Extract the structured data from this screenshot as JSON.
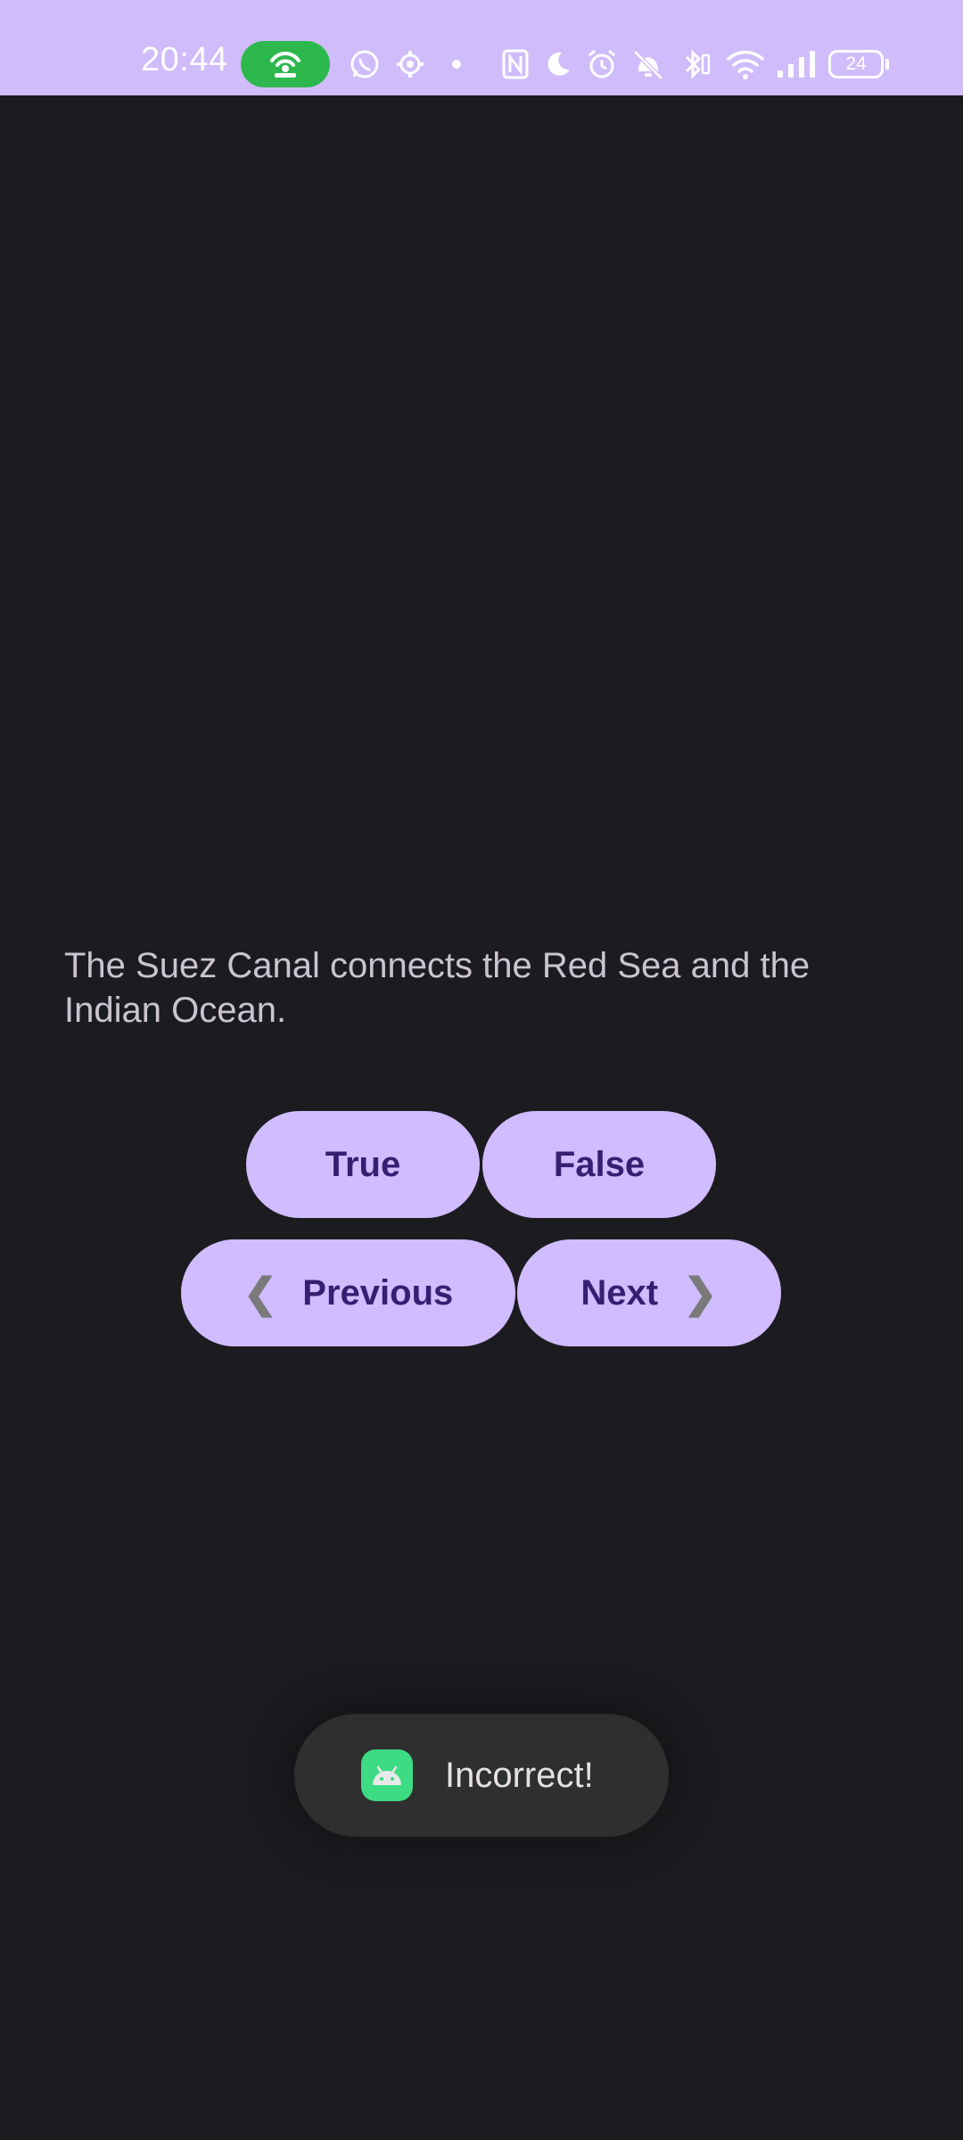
{
  "status_bar": {
    "time": "20:44",
    "battery_level": "24",
    "accent_color": "#d0bcfa",
    "icons": [
      "hotspot-icon",
      "whatsapp-icon",
      "settings-gear-icon",
      "dot-icon",
      "nfc-icon",
      "moon-icon",
      "alarm-icon",
      "vibrate-off-icon",
      "bluetooth-icon",
      "wifi-icon",
      "signal-icon",
      "battery-icon"
    ]
  },
  "quiz": {
    "question": "The Suez Canal connects the Red Sea and the Indian Ocean.",
    "true_label": "True",
    "false_label": "False",
    "previous_label": "Previous",
    "next_label": "Next",
    "previous_chevron": "❮",
    "next_chevron": "❯"
  },
  "toast": {
    "message": "Incorrect!",
    "icon": "android-icon"
  },
  "colors": {
    "background": "#1c1b1f",
    "button_bg": "#d0bcff",
    "button_text": "#381e72",
    "question_text": "#cac4d0"
  }
}
